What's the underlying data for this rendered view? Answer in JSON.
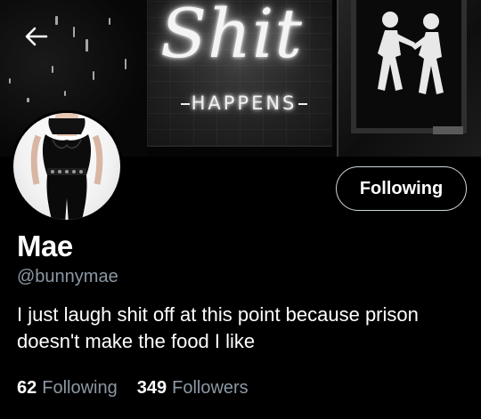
{
  "banner": {
    "neon_main": "Shit",
    "neon_sub": "HAPPENS"
  },
  "profile": {
    "display_name": "Mae",
    "handle": "@bunnymae",
    "bio": "I just laugh shit off at this point because prison doesn't make the food I like",
    "follow_button_label": "Following"
  },
  "stats": {
    "following_count": "62",
    "following_label": "Following",
    "followers_count": "349",
    "followers_label": "Followers"
  },
  "colors": {
    "background": "#000000",
    "secondary_text": "#8b98a5",
    "button_border": "#cfd9de"
  },
  "icons": {
    "back": "arrow-left-icon"
  }
}
